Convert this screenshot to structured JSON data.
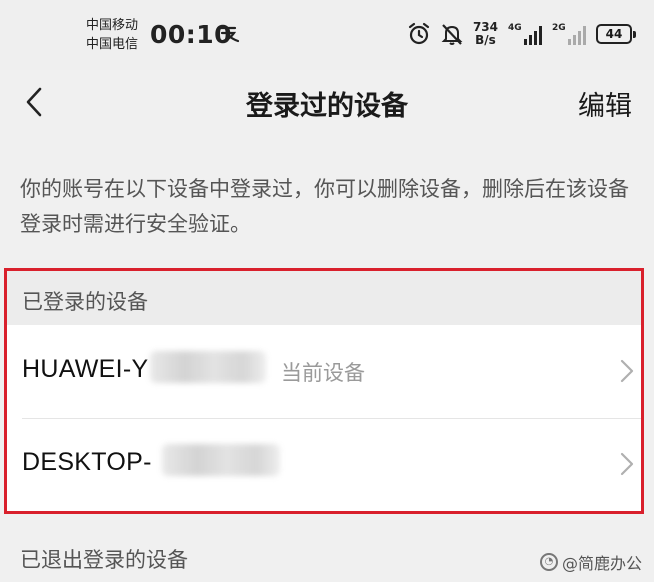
{
  "status_bar": {
    "carrier_1": "中国移动",
    "carrier_2": "中国电信",
    "time": "00:10",
    "net_speed_value": "734",
    "net_speed_unit": "B/s",
    "signal_1_label": "4G",
    "signal_2_label": "2G",
    "battery_level": "44"
  },
  "header": {
    "title": "登录过的设备",
    "edit_label": "编辑"
  },
  "description": "你的账号在以下设备中登录过，你可以删除设备，删除后在该设备登录时需进行安全验证。",
  "logged_in_section": {
    "title": "已登录的设备",
    "devices": [
      {
        "name": "HUAWEI-Y",
        "tag": "当前设备"
      },
      {
        "name": "DESKTOP-",
        "tag": ""
      }
    ]
  },
  "logged_out_section": {
    "title": "已退出登录的设备"
  },
  "watermark": {
    "text": "@简鹿办公"
  },
  "colors": {
    "highlight": "#d9202c",
    "background": "#f0f0f0"
  }
}
